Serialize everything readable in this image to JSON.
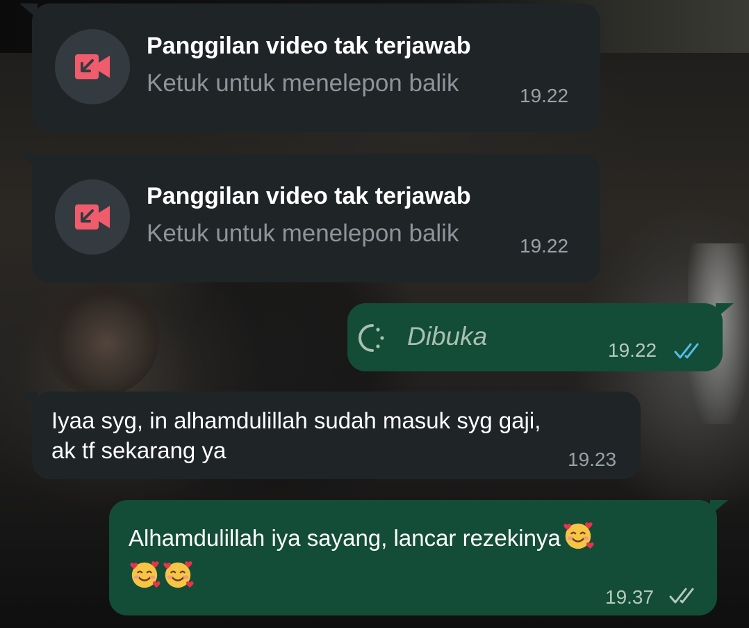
{
  "chat": {
    "messages": [
      {
        "type": "missed_video_call",
        "direction": "incoming",
        "title": "Panggilan video tak terjawab",
        "subtitle": "Ketuk untuk menelepon balik",
        "time": "19.22",
        "icon": "missed-video-call-icon"
      },
      {
        "type": "missed_video_call",
        "direction": "incoming",
        "title": "Panggilan video tak terjawab",
        "subtitle": "Ketuk untuk menelepon balik",
        "time": "19.22",
        "icon": "missed-video-call-icon"
      },
      {
        "type": "view_once_opened",
        "direction": "outgoing",
        "status_text": "Dibuka",
        "time": "19.22",
        "ticks": "double-check-read",
        "icon": "view-once-icon"
      },
      {
        "type": "text",
        "direction": "incoming",
        "lines": [
          "Iyaa syg, in alhamdulillah sudah masuk syg gaji,",
          "ak tf sekarang ya"
        ],
        "time": "19.23"
      },
      {
        "type": "text",
        "direction": "outgoing",
        "lines": [
          "Alhamdulillah iya sayang, lancar rezekinya"
        ],
        "emoji": [
          "smiling-face-with-hearts",
          "smiling-face-with-hearts",
          "smiling-face-with-hearts"
        ],
        "time": "19.37",
        "ticks": "double-check-delivered"
      }
    ]
  },
  "colors": {
    "incoming_bubble": "#1f2427",
    "outgoing_bubble": "#134d37",
    "missed_call_red": "#f15c6d",
    "read_ticks": "#53bdeb",
    "delivered_ticks": "#b6c8bd"
  }
}
